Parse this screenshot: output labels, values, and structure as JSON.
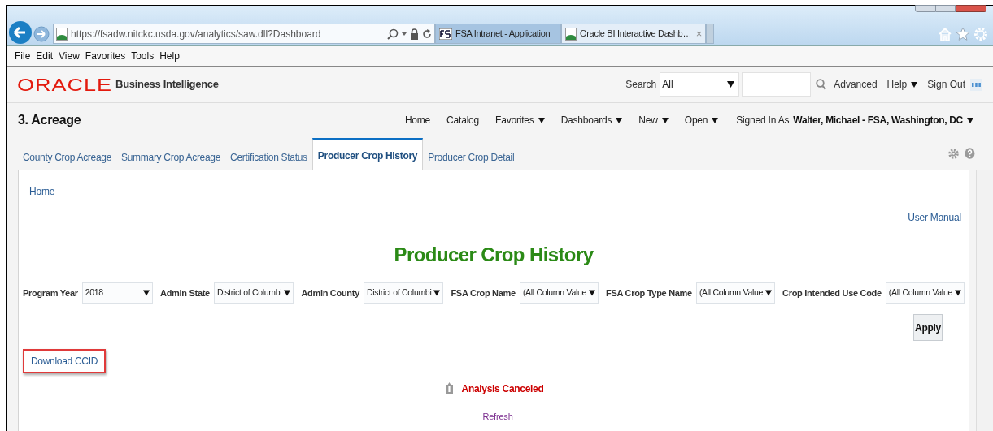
{
  "browser": {
    "url": "https://fsadw.nitckc.usda.gov/analytics/saw.dll?Dashboard",
    "tabs": [
      {
        "title": "FSA Intranet - Application",
        "selected": false
      },
      {
        "title": "Oracle BI Interactive Dashb…",
        "selected": true,
        "close": "×"
      }
    ]
  },
  "menu_bar": [
    "File",
    "Edit",
    "View",
    "Favorites",
    "Tools",
    "Help"
  ],
  "app_header": {
    "logo": "ORACLE",
    "product": "Business Intelligence",
    "search_label": "Search",
    "search_scope": "All",
    "links": [
      {
        "label": "Advanced",
        "menu": false
      },
      {
        "label": "Help",
        "menu": true
      },
      {
        "label": "Sign Out",
        "menu": false
      }
    ]
  },
  "title_bar": {
    "title": "3. Acreage",
    "nav": [
      {
        "label": "Home",
        "menu": false
      },
      {
        "label": "Catalog",
        "menu": false
      },
      {
        "label": "Favorites",
        "menu": true
      },
      {
        "label": "Dashboards",
        "menu": true
      },
      {
        "label": "New",
        "menu": true
      },
      {
        "label": "Open",
        "menu": true
      }
    ],
    "signed_in_label": "Signed In As",
    "user": "Walter, Michael - FSA, Washington, DC"
  },
  "tabs": [
    {
      "label": "County Crop Acreage",
      "selected": false
    },
    {
      "label": "Summary Crop Acreage",
      "selected": false
    },
    {
      "label": "Certification Status",
      "selected": false
    },
    {
      "label": "Producer Crop History",
      "selected": true
    },
    {
      "label": "Producer Crop Detail",
      "selected": false
    }
  ],
  "content": {
    "breadcrumb": "Home",
    "user_manual": "User Manual",
    "title": "Producer Crop History",
    "prompts": [
      {
        "label": "Program Year",
        "value": "2018"
      },
      {
        "label": "Admin State",
        "value": "District of Columbi"
      },
      {
        "label": "Admin County",
        "value": "District of Columbi"
      },
      {
        "label": "FSA Crop Name",
        "value": "(All Column Value"
      },
      {
        "label": "FSA Crop Type Name",
        "value": "(All Column Value"
      },
      {
        "label": "Crop Intended Use Code",
        "value": "(All Column Value"
      }
    ],
    "apply": "Apply",
    "download": {
      "label": "Download CCID",
      "highlighted": true
    },
    "message": "Analysis Canceled",
    "refresh": "Refresh"
  }
}
